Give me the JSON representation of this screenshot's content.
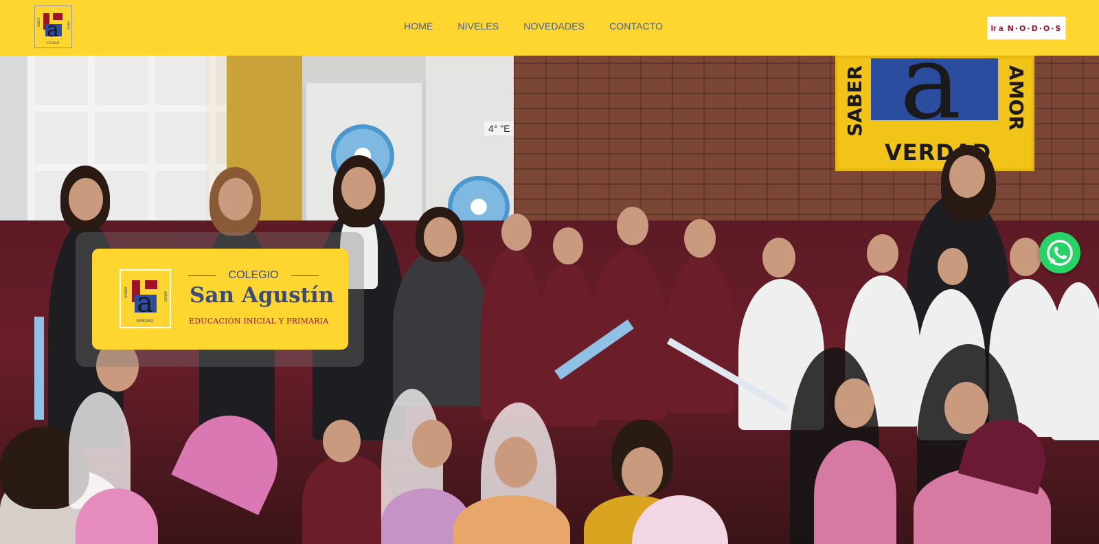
{
  "header": {
    "logo_icon": "school-crest-icon",
    "nav": [
      {
        "label": "HOME"
      },
      {
        "label": "NIVELES"
      },
      {
        "label": "NOVEDADES"
      },
      {
        "label": "CONTACTO"
      }
    ],
    "nodos_button": {
      "prefix": "Ir a",
      "brand": "N·O·D·O·S"
    }
  },
  "logo": {
    "letter": "a",
    "left_word": "SABER",
    "right_word": "AMOR",
    "bottom_word": "VERDAD"
  },
  "hero": {
    "banner": {
      "left_word": "SABER",
      "right_word": "AMOR",
      "bottom_word": "VERDAD"
    },
    "room_sign": "4° \"E",
    "card": {
      "kicker": "COLEGIO",
      "title": "San Agustín",
      "subtitle": "EDUCACIÓN INICIAL Y PRIMARIA"
    }
  },
  "whatsapp": {
    "icon": "whatsapp-icon"
  },
  "colors": {
    "header_bg": "#FFD530",
    "nav_text": "#4a5f8c",
    "brand_red": "#a01227",
    "brand_blue": "#3c4c7a",
    "whatsapp": "#25D366"
  }
}
